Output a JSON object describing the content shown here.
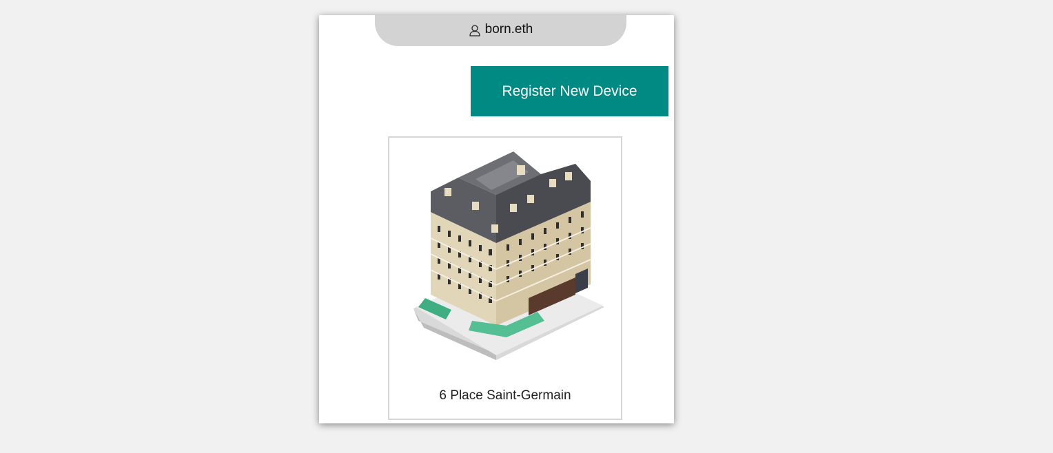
{
  "account": {
    "name": "born.eth",
    "icon": "user-icon"
  },
  "actions": {
    "register_label": "Register New Device",
    "register_color": "#008a84"
  },
  "property": {
    "title": "6 Place Saint-Germain",
    "image_icon": "isometric-building-image"
  }
}
